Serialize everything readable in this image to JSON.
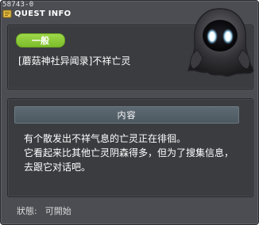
{
  "quest_id": "58743-0",
  "title": "QUEST INFO",
  "category": "一般",
  "quest_name": "[蘑菇神社异闻录]不祥亡灵",
  "section_header": "内容",
  "description": [
    "有个散发出不祥气息的亡灵正在徘徊。",
    "它看起来比其他亡灵阴森得多，但为了搜集信息，",
    "去跟它对话吧。"
  ],
  "status": {
    "label": "狀態:",
    "value": "可開始"
  },
  "colors": {
    "badge_green": "#8fcc3a",
    "window_bg": "#4b4d52",
    "panel_bg": "#3a3c40",
    "header_bg": "#56636b"
  },
  "icons": {
    "title_icon": "quest-scroll-icon",
    "npc_portrait": "hooded-ghost-portrait"
  }
}
